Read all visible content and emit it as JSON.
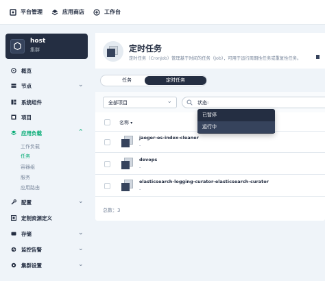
{
  "topnav": {
    "platform": "平台管理",
    "apps": "应用商店",
    "workbench": "工作台"
  },
  "cluster": {
    "name": "host",
    "type": "集群"
  },
  "sidebar": {
    "items": [
      {
        "label": "概览"
      },
      {
        "label": "节点"
      },
      {
        "label": "系统组件"
      },
      {
        "label": "项目"
      },
      {
        "label": "应用负载"
      },
      {
        "label": "配置"
      },
      {
        "label": "定制资源定义"
      },
      {
        "label": "存储"
      },
      {
        "label": "监控告警"
      },
      {
        "label": "集群设置"
      }
    ],
    "sub": [
      {
        "label": "工作负载"
      },
      {
        "label": "任务"
      },
      {
        "label": "容器组"
      },
      {
        "label": "服务"
      },
      {
        "label": "应用路由"
      }
    ]
  },
  "header": {
    "title": "定时任务",
    "desc": "定时任务（CronJob）管理基于时间的任务（Job），可用于运行周期性任务或重复性任务。"
  },
  "tabs": [
    {
      "label": "任务"
    },
    {
      "label": "定时任务"
    }
  ],
  "toolbar": {
    "project": "全部项目",
    "search": "状态:"
  },
  "table": {
    "header": "名称",
    "rows": [
      {
        "name": "jaeger-es-index-cleaner",
        "sub": "-"
      },
      {
        "name": "devops",
        "sub": "-"
      },
      {
        "name": "elasticsearch-logging-curator-elasticsearch-curator",
        "sub": "-"
      }
    ],
    "total": "总数：3"
  },
  "dropdown": {
    "options": [
      {
        "label": "已暂停"
      },
      {
        "label": "运行中"
      }
    ]
  },
  "colors": {
    "accent": "#00aa72",
    "dark": "#242e42",
    "bg": "#eff4f9"
  }
}
